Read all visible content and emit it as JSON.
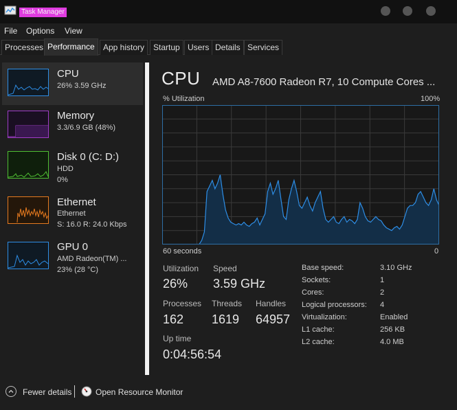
{
  "window": {
    "title": "Task Manager"
  },
  "menu": [
    "File",
    "Options",
    "View"
  ],
  "tabs": [
    "Processes",
    "Performance",
    "App history",
    "Startup",
    "Users",
    "Details",
    "Services"
  ],
  "active_tab": "Performance",
  "sidebar": {
    "items": [
      {
        "title": "CPU",
        "line1": "26%  3.59 GHz",
        "line2": "",
        "color": "#2e8ee6",
        "selected": true
      },
      {
        "title": "Memory",
        "line1": "3.3/6.9 GB (48%)",
        "line2": "",
        "color": "#a03dc8",
        "selected": false
      },
      {
        "title": "Disk 0 (C: D:)",
        "line1": "HDD",
        "line2": "0%",
        "color": "#4fbf33",
        "selected": false
      },
      {
        "title": "Ethernet",
        "line1": "Ethernet",
        "line2": "S: 16.0  R: 24.0 Kbps",
        "color": "#e67a1f",
        "selected": false
      },
      {
        "title": "GPU 0",
        "line1": "AMD Radeon(TM) ...",
        "line2": "23%  (28 °C)",
        "color": "#2e8ee6",
        "selected": false
      }
    ]
  },
  "cpu": {
    "heading": "CPU",
    "model": "AMD A8-7600 Radeon R7, 10 Compute Cores ...",
    "util_label": "% Utilization",
    "util_max": "100%",
    "seconds_label": "60 seconds",
    "zero_label": "0",
    "graph_line_color": "#2e8ee6",
    "graph_border_color": "#2e6fa6",
    "graph_history": [
      0,
      0,
      0,
      0,
      0,
      0,
      0,
      0,
      0,
      0,
      0,
      0,
      0,
      0,
      0,
      3,
      9,
      38,
      42,
      46,
      40,
      44,
      50,
      36,
      25,
      19,
      16,
      15,
      14,
      15,
      14,
      16,
      14,
      13,
      15,
      16,
      19,
      14,
      18,
      22,
      38,
      44,
      36,
      40,
      46,
      33,
      20,
      18,
      32,
      40,
      46,
      38,
      28,
      26,
      30,
      34,
      28,
      24,
      30,
      34,
      38,
      26,
      18,
      16,
      18,
      20,
      16,
      15,
      18,
      20,
      16,
      18,
      17,
      15,
      18,
      30,
      26,
      20,
      17,
      16,
      18,
      20,
      18,
      17,
      14,
      12,
      11,
      10,
      12,
      13,
      11,
      14,
      20,
      26,
      28,
      28,
      30,
      36,
      38,
      34,
      30,
      28,
      32,
      40,
      32,
      28
    ],
    "stats": {
      "utilization": {
        "label": "Utilization",
        "value": "26%"
      },
      "speed": {
        "label": "Speed",
        "value": "3.59 GHz"
      },
      "processes": {
        "label": "Processes",
        "value": "162"
      },
      "threads": {
        "label": "Threads",
        "value": "1619"
      },
      "handles": {
        "label": "Handles",
        "value": "64957"
      },
      "uptime": {
        "label": "Up time",
        "value": "0:04:56:54"
      }
    },
    "specs": [
      {
        "label": "Base speed:",
        "value": "3.10 GHz"
      },
      {
        "label": "Sockets:",
        "value": "1"
      },
      {
        "label": "Cores:",
        "value": "2"
      },
      {
        "label": "Logical processors:",
        "value": "4"
      },
      {
        "label": "Virtualization:",
        "value": "Enabled"
      },
      {
        "label": "L1 cache:",
        "value": "256 KB"
      },
      {
        "label": "L2 cache:",
        "value": "4.0 MB"
      }
    ]
  },
  "footer": {
    "fewer_details": "Fewer details",
    "open_resource_monitor": "Open Resource Monitor"
  }
}
